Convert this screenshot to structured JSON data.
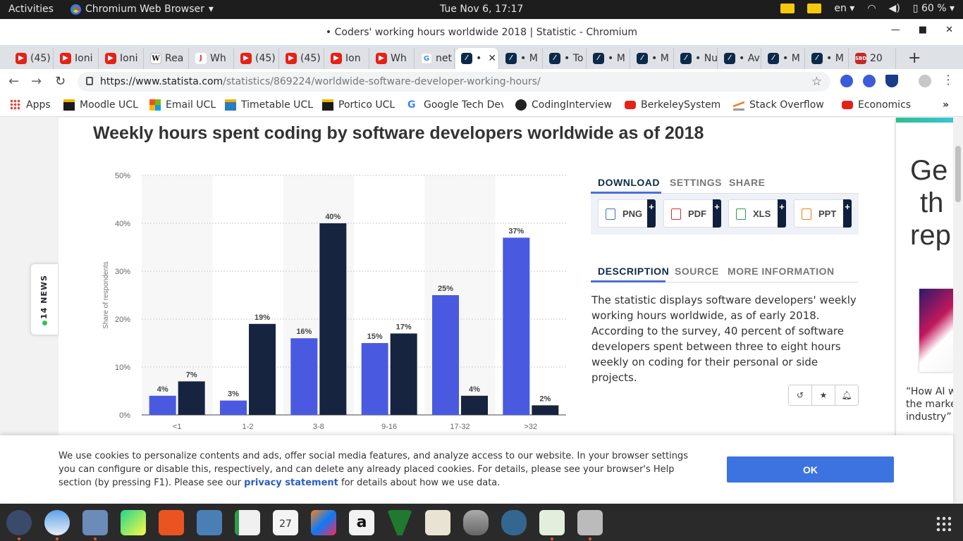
{
  "topbar": {
    "activities": "Activities",
    "app_name": "Chromium Web Browser",
    "app_menu_icon": "chevron-down-icon",
    "clock": "Tue Nov  6, 17:17",
    "language": "en",
    "battery": "60 %"
  },
  "window": {
    "title": "• Coders' working hours worldwide 2018 | Statistic - Chromium"
  },
  "tabs": [
    {
      "label": "(45)",
      "icon": "youtube-icon"
    },
    {
      "label": "Ioni",
      "icon": "youtube-icon"
    },
    {
      "label": "Ioni",
      "icon": "youtube-icon"
    },
    {
      "label": "Rea",
      "icon": "wikipedia-icon"
    },
    {
      "label": "Wh",
      "icon": "j-icon"
    },
    {
      "label": "(45)",
      "icon": "youtube-icon"
    },
    {
      "label": "(45)",
      "icon": "youtube-icon"
    },
    {
      "label": "Ion",
      "icon": "youtube-icon"
    },
    {
      "label": "Wh",
      "icon": "youtube-icon"
    },
    {
      "label": "net",
      "icon": "google-icon"
    },
    {
      "label": "•",
      "icon": "statista-icon",
      "active": true
    },
    {
      "label": "• M",
      "icon": "statista-icon"
    },
    {
      "label": "• To",
      "icon": "statista-icon"
    },
    {
      "label": "• M",
      "icon": "statista-icon"
    },
    {
      "label": "• M",
      "icon": "statista-icon"
    },
    {
      "label": "• Nu",
      "icon": "statista-icon"
    },
    {
      "label": "• Av",
      "icon": "statista-icon"
    },
    {
      "label": "• M",
      "icon": "statista-icon"
    },
    {
      "label": "• M",
      "icon": "statista-icon"
    },
    {
      "label": "20",
      "icon": "sbd-icon"
    }
  ],
  "toolbar": {
    "url_host": "https://www.statista.com",
    "url_path": "/statistics/869224/worldwide-software-developer-working-hours/"
  },
  "bookmarks": [
    {
      "label": "Apps",
      "icon": "apps-grid-icon"
    },
    {
      "label": "Moodle UCL",
      "icon": "ucl-icon"
    },
    {
      "label": "Email UCL",
      "icon": "microsoft-icon"
    },
    {
      "label": "Timetable UCL",
      "icon": "ucl-icon"
    },
    {
      "label": "Portico UCL",
      "icon": "ucl-icon"
    },
    {
      "label": "Google Tech Dev",
      "icon": "google-icon"
    },
    {
      "label": "CodingInterview",
      "icon": "github-icon"
    },
    {
      "label": "BerkeleySystems",
      "icon": "youtube-icon"
    },
    {
      "label": "Stack Overflow",
      "icon": "stackoverflow-icon"
    },
    {
      "label": "Economics",
      "icon": "youtube-icon"
    }
  ],
  "page": {
    "title": "Weekly hours spent coding by software developers worldwide as of 2018",
    "news_tab": "14 NEWS",
    "download_tabs": [
      "DOWNLOAD",
      "SETTINGS",
      "SHARE"
    ],
    "download_buttons": [
      "PNG",
      "PDF",
      "XLS",
      "PPT"
    ],
    "info_tabs": [
      "DESCRIPTION",
      "SOURCE",
      "MORE INFORMATION"
    ],
    "description": "The statistic displays software developers' weekly working hours worldwide, as of early 2018. According to the survey, 40 percent of software developers spent between three to eight hours weekly on coding for their personal or side projects.",
    "ad_headline": [
      "Ge",
      "th",
      "rep"
    ],
    "ad_quote": [
      "“How AI w",
      "the marke",
      "industry”"
    ]
  },
  "chart_data": {
    "type": "bar",
    "title": "Weekly hours spent coding by software developers worldwide as of 2018",
    "xlabel": "",
    "ylabel": "Share of respondents",
    "categories": [
      "<1",
      "1-2",
      "3-8",
      "9-16",
      "17-32",
      ">32"
    ],
    "series": [
      {
        "values": [
          4,
          3,
          16,
          15,
          25,
          37
        ],
        "color": "#4a5ae0"
      },
      {
        "values": [
          7,
          19,
          40,
          17,
          4,
          2
        ],
        "color": "#17243f"
      }
    ],
    "yticks": [
      "0%",
      "10%",
      "20%",
      "30%",
      "40%",
      "50%"
    ],
    "ylim": [
      0,
      50
    ],
    "grid": true
  },
  "cookie": {
    "text_before": "We use cookies to personalize contents and ads, offer social media features, and analyze access to our website. In your browser settings you can configure or disable this, respectively, and can delete any already placed cookies. For details, please see your browser's Help section (by pressing F1). Please see our ",
    "link": "privacy statement",
    "text_after": " for details about how we use data.",
    "ok": "OK"
  },
  "dock": [
    "chromium-icon",
    "thunderbird-icon",
    "files-icon",
    "pycharm-icon",
    "software-center-icon",
    "image-viewer-icon",
    "spreadsheet-icon",
    "calendar-icon",
    "intellij-icon",
    "amazon-icon",
    "vim-icon",
    "text-editor-icon",
    "database-icon",
    "postgresql-icon",
    "chart-tool-icon",
    "screen-icon"
  ],
  "dock_calendar_day": "27"
}
